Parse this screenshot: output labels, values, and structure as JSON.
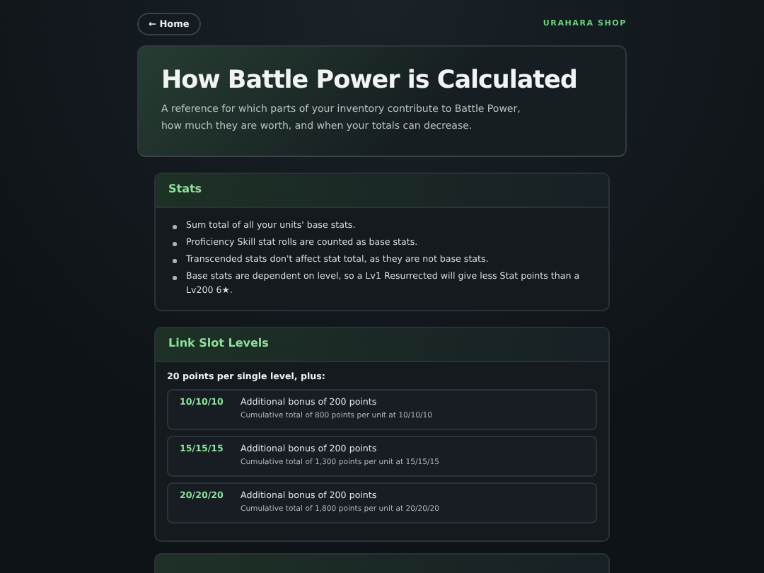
{
  "nav": {
    "home": "← Home",
    "brand": "URAHARA SHOP"
  },
  "hero": {
    "title": "How Battle Power is Calculated",
    "subtitle": "A reference for which parts of your inventory contribute to Battle Power, how much they are worth, and when your totals can decrease."
  },
  "stats": {
    "title": "Stats",
    "bullets": [
      "Sum total of all your units' base stats.",
      "Proficiency Skill stat rolls are counted as base stats.",
      "Transcended stats don't affect stat total, as they are not base stats.",
      "Base stats are dependent on level, so a Lv1 Resurrected will give less Stat points than a Lv200 6★."
    ]
  },
  "link_slots": {
    "title": "Link Slot Levels",
    "intro": "20 points per single level, plus:",
    "tiers": [
      {
        "level": "10/10/10",
        "bonus": "Additional bonus of 200 points",
        "note": "Cumulative total of 800 points per unit at 10/10/10"
      },
      {
        "level": "15/15/15",
        "bonus": "Additional bonus of 200 points",
        "note": "Cumulative total of 1,300 points per unit at 15/15/15"
      },
      {
        "level": "20/20/20",
        "bonus": "Additional bonus of 200 points",
        "note": "Cumulative total of 1,800 points per unit at 20/20/20"
      }
    ]
  }
}
